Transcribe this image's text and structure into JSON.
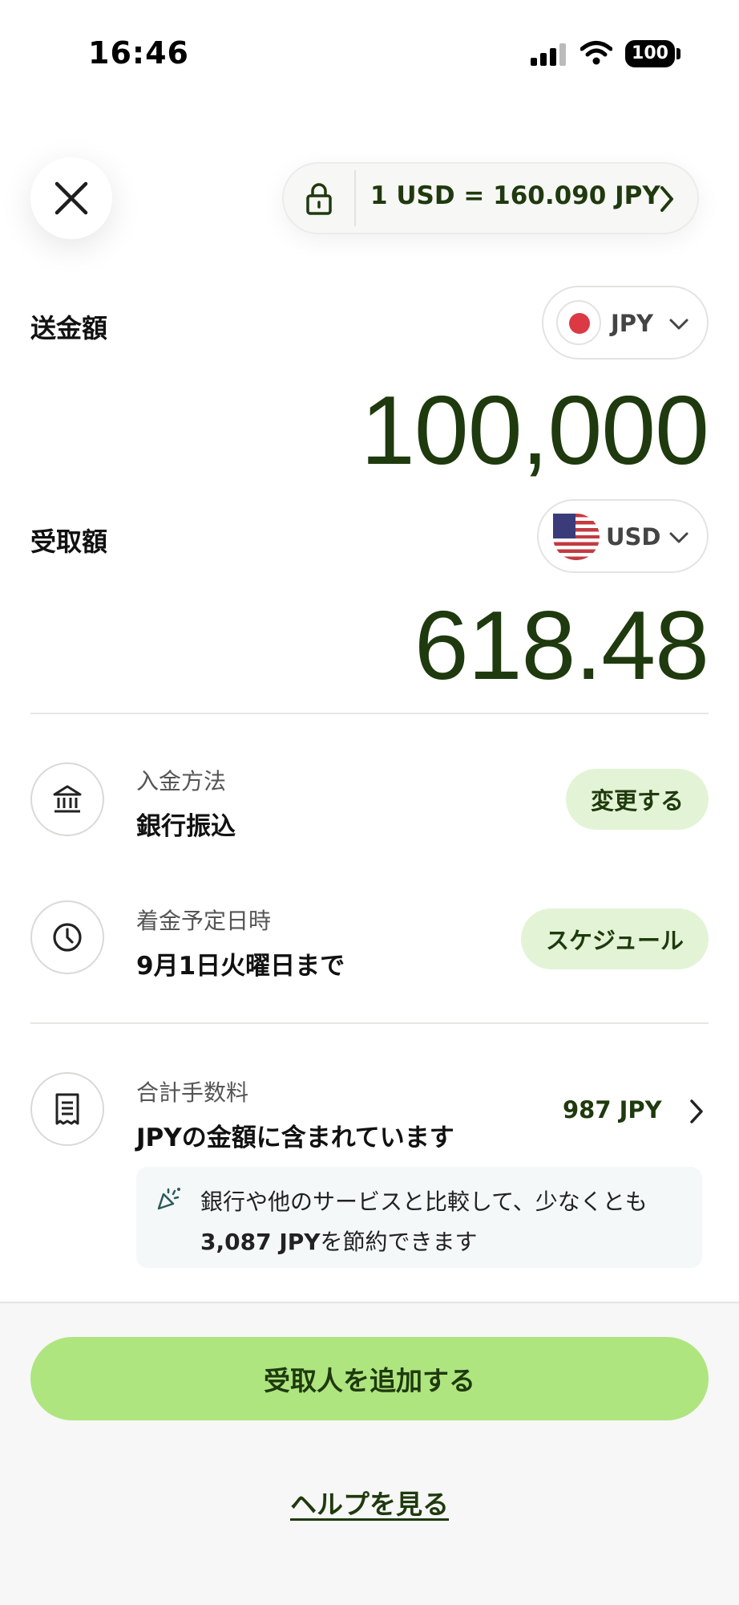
{
  "status_bar": {
    "time": "16:46",
    "battery": "100"
  },
  "rate": {
    "text": "1 USD = 160.090 JPY"
  },
  "send": {
    "label": "送金額",
    "currency": "JPY",
    "amount": "100,000"
  },
  "receive": {
    "label": "受取額",
    "currency": "USD",
    "amount": "618.48"
  },
  "payment_method": {
    "title": "入金方法",
    "value": "銀行振込",
    "action": "変更する"
  },
  "arrival": {
    "title": "着金予定日時",
    "value": "9月1日火曜日まで",
    "action": "スケジュール"
  },
  "fees": {
    "title": "合計手数料",
    "value": "JPYの金額に含まれています",
    "amount": "987 JPY",
    "savings_line1": "銀行や他のサービスと比較して、少なくとも",
    "savings_amount": "3,087 JPY",
    "savings_line2_suffix": "を節約できます"
  },
  "actions": {
    "primary": "受取人を追加する",
    "help": "ヘルプを見る"
  },
  "colors": {
    "accent": "#aee57f",
    "dark_green": "#1f3a0e",
    "pill_bg": "#e3f4d6",
    "jp_red": "#db3a45"
  },
  "icons": [
    "close-icon",
    "lock-icon",
    "chevron-right-icon",
    "chevron-down-icon",
    "bank-icon",
    "clock-icon",
    "receipt-icon",
    "party-popper-icon"
  ]
}
